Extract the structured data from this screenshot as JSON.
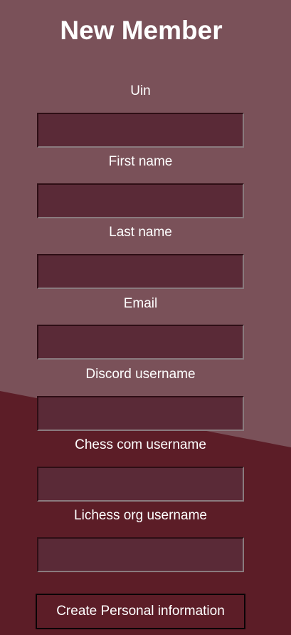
{
  "form": {
    "title": "New Member",
    "fields": [
      {
        "label": "Uin",
        "value": "",
        "placeholder": ""
      },
      {
        "label": "First name",
        "value": "",
        "placeholder": ""
      },
      {
        "label": "Last name",
        "value": "",
        "placeholder": ""
      },
      {
        "label": "Email",
        "value": "",
        "placeholder": ""
      },
      {
        "label": "Discord username",
        "value": "",
        "placeholder": ""
      },
      {
        "label": "Chess com username",
        "value": "",
        "placeholder": ""
      },
      {
        "label": "Lichess org username",
        "value": "",
        "placeholder": ""
      }
    ],
    "submit_label": "Create Personal information"
  },
  "colors": {
    "background_upper": "#7a5159",
    "background_lower": "#5c1d27",
    "input_fill": "#5a2a37",
    "text": "#ffffff"
  }
}
